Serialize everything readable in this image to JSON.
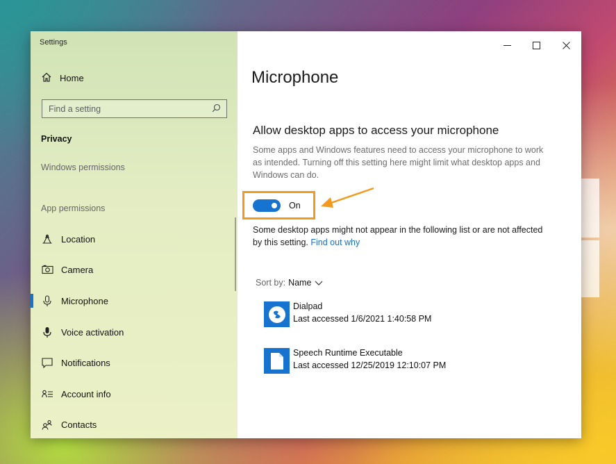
{
  "window": {
    "app_title": "Settings",
    "caption": {
      "minimize": "—",
      "maximize": "☐",
      "close": "✕"
    }
  },
  "sidebar": {
    "home_label": "Home",
    "search_placeholder": "Find a setting",
    "section_title": "Privacy",
    "windows_permissions_label": "Windows permissions",
    "app_permissions_label": "App permissions",
    "items": [
      {
        "label": "Location",
        "icon": "location-icon",
        "active": false
      },
      {
        "label": "Camera",
        "icon": "camera-icon",
        "active": false
      },
      {
        "label": "Microphone",
        "icon": "microphone-icon",
        "active": true
      },
      {
        "label": "Voice activation",
        "icon": "voice-activation-icon",
        "active": false
      },
      {
        "label": "Notifications",
        "icon": "notifications-icon",
        "active": false
      },
      {
        "label": "Account info",
        "icon": "account-info-icon",
        "active": false
      },
      {
        "label": "Contacts",
        "icon": "contacts-icon",
        "active": false
      }
    ]
  },
  "main": {
    "page_title": "Microphone",
    "section_title": "Allow desktop apps to access your microphone",
    "description": "Some apps and Windows features need to access your microphone to work as intended. Turning off this setting here might limit what desktop apps and Windows can do.",
    "toggle": {
      "state": "On",
      "on": true
    },
    "note_text": "Some desktop apps might not appear in the following list or are not affected by this setting.",
    "note_link": "Find out why",
    "sort_label": "Sort by:",
    "sort_value": "Name",
    "apps": [
      {
        "name": "Dialpad",
        "last_accessed": "Last accessed 1/6/2021 1:40:58 PM",
        "icon": "dialpad-icon"
      },
      {
        "name": "Speech Runtime Executable",
        "last_accessed": "Last accessed 12/25/2019 12:10:07 PM",
        "icon": "document-icon"
      }
    ]
  },
  "colors": {
    "accent": "#1673cf",
    "highlight": "#f39a1d",
    "link": "#1a6fc4"
  }
}
